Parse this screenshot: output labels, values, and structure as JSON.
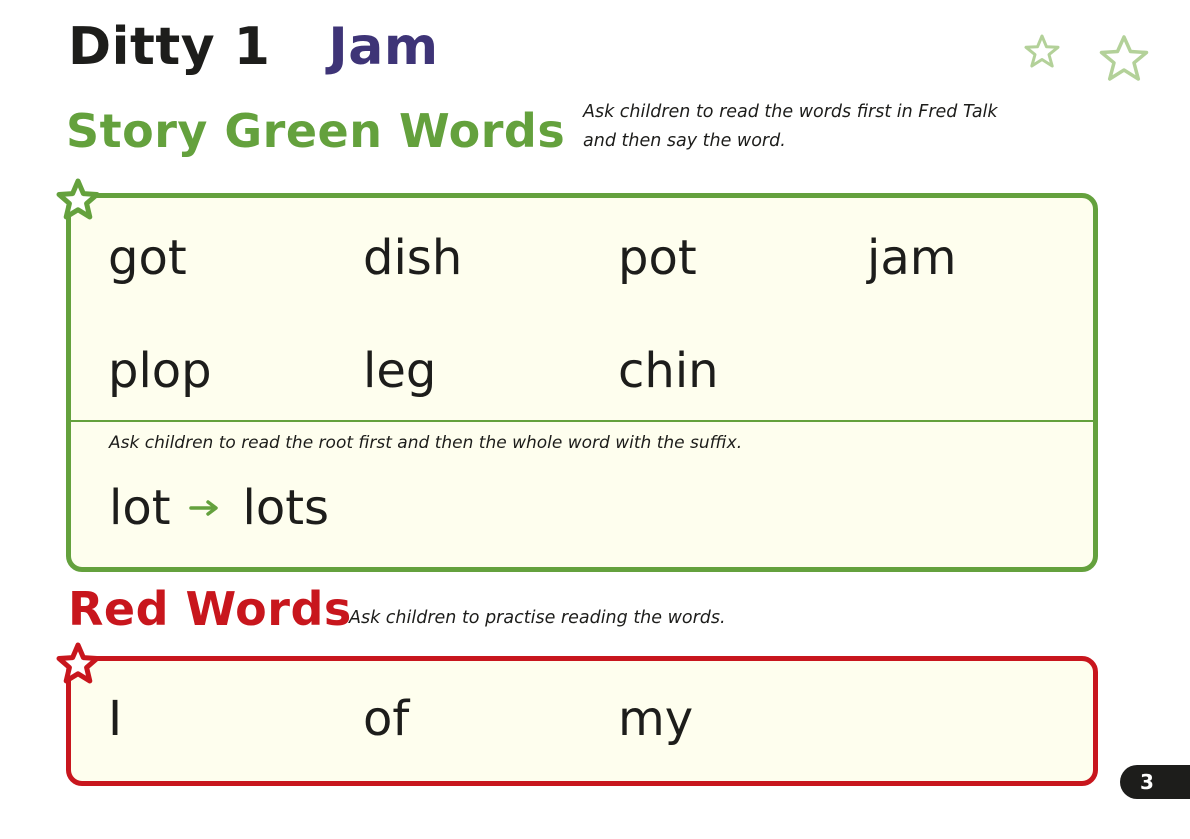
{
  "header": {
    "title": "Ditty 1",
    "subtitle": "Jam",
    "subtitle_color": "#3e3477"
  },
  "decorations": {
    "top_right_icons": [
      "star-outline-icon",
      "star-outline-icon"
    ],
    "star_color": "#b3d199"
  },
  "green_words": {
    "heading": "Story Green Words",
    "heading_color": "#64a13d",
    "note": "Ask children to read the words first in Fred Talk\nand then say the word.",
    "words": [
      "got",
      "dish",
      "pot",
      "jam",
      "plop",
      "leg",
      "chin"
    ],
    "suffix_note": "Ask children to read the root first and then the whole word with the suffix.",
    "suffix": {
      "root": "lot",
      "arrow_icon": "right-arrow-icon",
      "word": "lots"
    },
    "corner_icon": "star-icon"
  },
  "red_words": {
    "heading": "Red Words",
    "heading_color": "#c8161d",
    "note": "Ask children to practise reading the words.",
    "words": [
      "I",
      "of",
      "my"
    ],
    "corner_icon": "star-icon"
  },
  "footer": {
    "page_number": "3"
  }
}
